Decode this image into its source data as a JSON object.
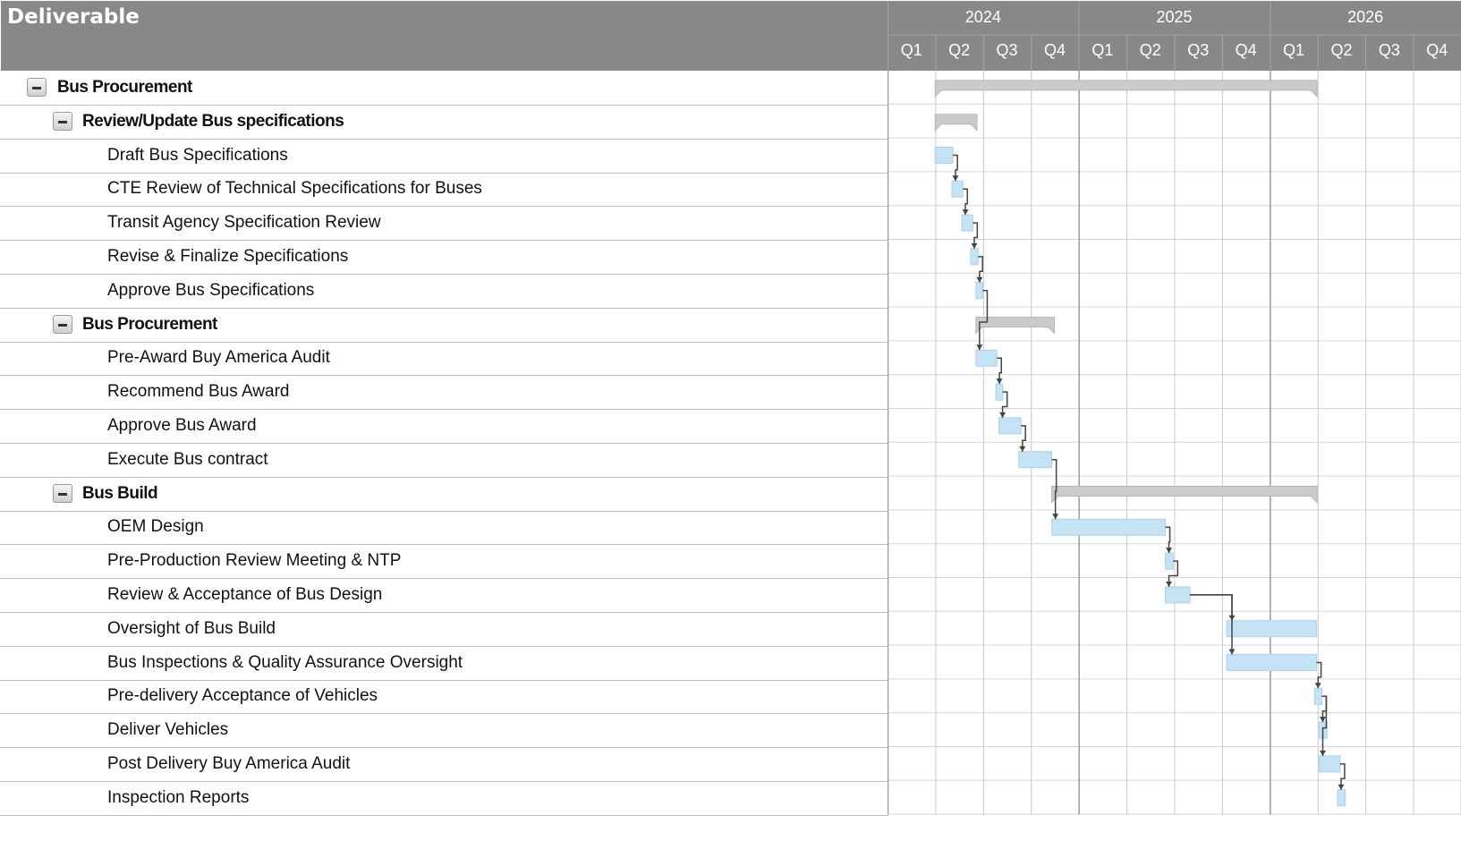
{
  "header": {
    "title": "Deliverable"
  },
  "chart_data": {
    "type": "gantt",
    "years": [
      "2024",
      "2025",
      "2026"
    ],
    "quarters": [
      "Q1",
      "Q2",
      "Q3",
      "Q4",
      "Q1",
      "Q2",
      "Q3",
      "Q4",
      "Q1",
      "Q2",
      "Q3",
      "Q4"
    ],
    "timeline": {
      "start": "2024-01-01",
      "end": "2027-01-01"
    },
    "tasks": [
      {
        "name": "Bus Procurement",
        "level": 0,
        "group": true,
        "start": "2024-04-01",
        "end": "2026-04-01"
      },
      {
        "name": "Review/Update Bus specifications",
        "level": 1,
        "group": true,
        "start": "2024-04-01",
        "end": "2024-06-20"
      },
      {
        "name": "Draft Bus Specifications",
        "level": 2,
        "group": false,
        "start": "2024-04-01",
        "end": "2024-05-05"
      },
      {
        "name": "CTE Review of Technical Specifications for Buses",
        "level": 2,
        "group": false,
        "start": "2024-05-03",
        "end": "2024-05-24"
      },
      {
        "name": "Transit Agency Specification Review",
        "level": 2,
        "group": false,
        "start": "2024-05-22",
        "end": "2024-06-12"
      },
      {
        "name": "Revise & Finalize Specifications",
        "level": 2,
        "group": false,
        "start": "2024-06-08",
        "end": "2024-06-22"
      },
      {
        "name": "Approve Bus Specifications",
        "level": 2,
        "group": false,
        "start": "2024-06-18",
        "end": "2024-07-01"
      },
      {
        "name": "Bus Procurement",
        "level": 1,
        "group": true,
        "start": "2024-06-18",
        "end": "2024-11-15"
      },
      {
        "name": "Pre-Award Buy America Audit",
        "level": 2,
        "group": false,
        "start": "2024-06-18",
        "end": "2024-07-28"
      },
      {
        "name": "Recommend Bus Award",
        "level": 2,
        "group": false,
        "start": "2024-07-26",
        "end": "2024-08-08"
      },
      {
        "name": "Approve Bus Award",
        "level": 2,
        "group": false,
        "start": "2024-08-01",
        "end": "2024-09-12"
      },
      {
        "name": "Execute Bus contract",
        "level": 2,
        "group": false,
        "start": "2024-09-08",
        "end": "2024-11-10"
      },
      {
        "name": "Bus Build",
        "level": 1,
        "group": true,
        "start": "2024-11-10",
        "end": "2026-04-01"
      },
      {
        "name": "OEM Design",
        "level": 2,
        "group": false,
        "start": "2024-11-10",
        "end": "2025-06-15"
      },
      {
        "name": "Pre-Production Review Meeting & NTP",
        "level": 2,
        "group": false,
        "start": "2025-06-15",
        "end": "2025-06-30"
      },
      {
        "name": "Review & Acceptance of Bus Design",
        "level": 2,
        "group": false,
        "start": "2025-06-15",
        "end": "2025-08-01"
      },
      {
        "name": "Oversight of Bus Build",
        "level": 2,
        "group": false,
        "start": "2025-10-10",
        "end": "2026-03-31"
      },
      {
        "name": "Bus Inspections & Quality Assurance Oversight",
        "level": 2,
        "group": false,
        "start": "2025-10-10",
        "end": "2026-03-31"
      },
      {
        "name": "Pre-delivery Acceptance of Vehicles",
        "level": 2,
        "group": false,
        "start": "2026-03-27",
        "end": "2026-04-10"
      },
      {
        "name": "Deliver Vehicles",
        "level": 2,
        "group": false,
        "start": "2026-04-05",
        "end": "2026-04-20"
      },
      {
        "name": "Post Delivery Buy America Audit",
        "level": 2,
        "group": false,
        "start": "2026-04-05",
        "end": "2026-05-15"
      },
      {
        "name": "Inspection Reports",
        "level": 2,
        "group": false,
        "start": "2026-05-10",
        "end": "2026-05-25"
      }
    ],
    "dependencies": [
      [
        2,
        3
      ],
      [
        3,
        4
      ],
      [
        4,
        5
      ],
      [
        5,
        6
      ],
      [
        6,
        8
      ],
      [
        8,
        9
      ],
      [
        9,
        10
      ],
      [
        10,
        11
      ],
      [
        11,
        13
      ],
      [
        13,
        14
      ],
      [
        14,
        15
      ],
      [
        15,
        16
      ],
      [
        15,
        17
      ],
      [
        17,
        18
      ],
      [
        18,
        19
      ],
      [
        18,
        20
      ],
      [
        20,
        21
      ]
    ],
    "colors": {
      "header": "#888888",
      "task_fill": "#c6e3f5",
      "task_stroke": "#a9d2ee",
      "summary_fill": "#cbcbcb",
      "summary_stroke": "#b5b5b5",
      "grid": "#c8c8c8",
      "year_grid": "#9a9a9a",
      "arrow": "#444444"
    }
  }
}
